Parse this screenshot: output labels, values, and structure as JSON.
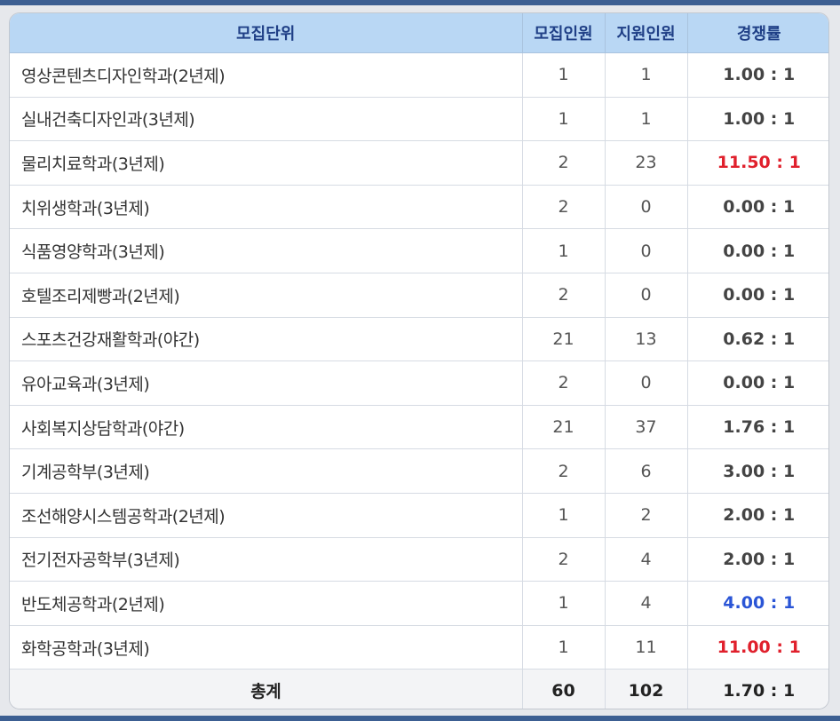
{
  "table": {
    "headers": {
      "unit": "모집단위",
      "recruit": "모집인원",
      "applicants": "지원인원",
      "ratio": "경쟁률"
    },
    "rows": [
      {
        "unit": "영상콘텐츠디자인학과(2년제)",
        "recruit": "1",
        "applicants": "1",
        "ratio": "1.00 : 1",
        "highlight": "none"
      },
      {
        "unit": "실내건축디자인과(3년제)",
        "recruit": "1",
        "applicants": "1",
        "ratio": "1.00 : 1",
        "highlight": "none"
      },
      {
        "unit": "물리치료학과(3년제)",
        "recruit": "2",
        "applicants": "23",
        "ratio": "11.50 : 1",
        "highlight": "red"
      },
      {
        "unit": "치위생학과(3년제)",
        "recruit": "2",
        "applicants": "0",
        "ratio": "0.00 : 1",
        "highlight": "none"
      },
      {
        "unit": "식품영양학과(3년제)",
        "recruit": "1",
        "applicants": "0",
        "ratio": "0.00 : 1",
        "highlight": "none"
      },
      {
        "unit": "호텔조리제빵과(2년제)",
        "recruit": "2",
        "applicants": "0",
        "ratio": "0.00 : 1",
        "highlight": "none"
      },
      {
        "unit": "스포츠건강재활학과(야간)",
        "recruit": "21",
        "applicants": "13",
        "ratio": "0.62 : 1",
        "highlight": "none"
      },
      {
        "unit": "유아교육과(3년제)",
        "recruit": "2",
        "applicants": "0",
        "ratio": "0.00 : 1",
        "highlight": "none"
      },
      {
        "unit": "사회복지상담학과(야간)",
        "recruit": "21",
        "applicants": "37",
        "ratio": "1.76 : 1",
        "highlight": "none"
      },
      {
        "unit": "기계공학부(3년제)",
        "recruit": "2",
        "applicants": "6",
        "ratio": "3.00 : 1",
        "highlight": "none"
      },
      {
        "unit": "조선해양시스템공학과(2년제)",
        "recruit": "1",
        "applicants": "2",
        "ratio": "2.00 : 1",
        "highlight": "none"
      },
      {
        "unit": "전기전자공학부(3년제)",
        "recruit": "2",
        "applicants": "4",
        "ratio": "2.00 : 1",
        "highlight": "none"
      },
      {
        "unit": "반도체공학과(2년제)",
        "recruit": "1",
        "applicants": "4",
        "ratio": "4.00 : 1",
        "highlight": "blue"
      },
      {
        "unit": "화학공학과(3년제)",
        "recruit": "1",
        "applicants": "11",
        "ratio": "11.00 : 1",
        "highlight": "red"
      }
    ],
    "total": {
      "label": "총계",
      "recruit": "60",
      "applicants": "102",
      "ratio": "1.70 : 1"
    }
  },
  "colors": {
    "header_bg": "#b9d7f4",
    "header_text": "#1f3f86",
    "red": "#e0202c",
    "blue": "#2a55d6",
    "frame": "#3c5f92"
  }
}
